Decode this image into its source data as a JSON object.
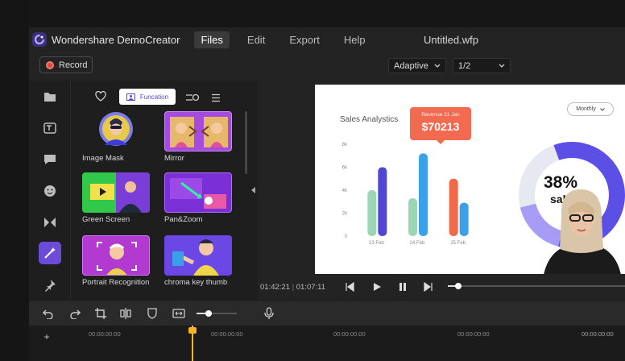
{
  "app": {
    "name": "Wondershare DemoCreator",
    "document_title": "Untitled.wfp"
  },
  "menu": [
    {
      "label": "Files",
      "active": true
    },
    {
      "label": "Edit",
      "active": false
    },
    {
      "label": "Export",
      "active": false
    },
    {
      "label": "Help",
      "active": false
    }
  ],
  "toolbar": {
    "record_label": "Record",
    "view_mode": "Adaptive",
    "zoom": "1/2"
  },
  "panel": {
    "active_tab": "Funcation",
    "cards": [
      {
        "label": "Image Mask"
      },
      {
        "label": "Mirror"
      },
      {
        "label": "Green Screen"
      },
      {
        "label": "Pan&Zoom"
      },
      {
        "label": "Portrait Recognition"
      },
      {
        "label": "chroma key thumb"
      }
    ]
  },
  "slide": {
    "title": "Sales Analystics",
    "tooltip_label": "Revenue 21 Jan",
    "tooltip_value": "$70213",
    "dropdown": "Monthly",
    "donut_percent": "38%",
    "donut_caption": "sal"
  },
  "chart_data": {
    "type": "bar",
    "title": "Sales Analystics",
    "categories": [
      "23 Feb",
      "24 Feb",
      "25 Feb"
    ],
    "yticks": [
      "0",
      "2k",
      "4k",
      "6k",
      "8k"
    ],
    "ylim": [
      0,
      8000
    ],
    "series": [
      {
        "values": [
          4000,
          3300,
          5000
        ],
        "color": "#9ad6b4"
      },
      {
        "values": [
          6000,
          7200,
          2900
        ],
        "color": "#4f5bd5"
      }
    ],
    "bar_colors": [
      [
        "#9ad6b4",
        "#4f46d6"
      ],
      [
        "#9ad6b4",
        "#3aa0e8"
      ],
      [
        "#f06a4a",
        "#3aa0e8"
      ]
    ]
  },
  "playback": {
    "current": "01:42:21",
    "total": "01:07:11",
    "progress": 0.06
  },
  "timeline": {
    "ticks": [
      "00:00:00:00",
      "00:00:00:00",
      "00:00:00:00",
      "00:00:00:00",
      "00:00:00:00",
      "00:00:00:00",
      "00:00:00:00"
    ],
    "zoom": 0.3
  },
  "colors": {
    "accent": "#6b4bd8",
    "record": "#e0483e",
    "playhead": "#f5b52a"
  }
}
